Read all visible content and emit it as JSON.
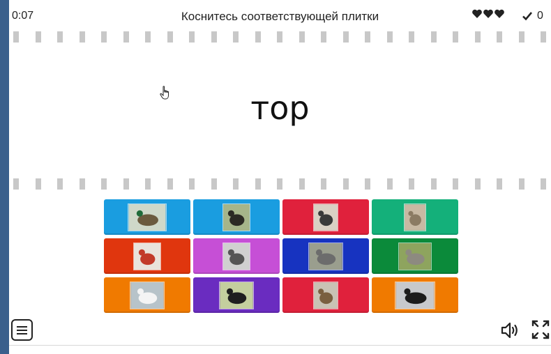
{
  "header": {
    "timer": "0:07",
    "prompt": "Коснитесь соответствующей плитки",
    "lives": 3,
    "score": "0",
    "heart_icon": "heart-icon",
    "check_icon": "checkmark-icon"
  },
  "question": {
    "word": "тор"
  },
  "tiles": [
    {
      "color": "#1a9de0",
      "image": "mallard-duck-photo"
    },
    {
      "color": "#1a9de0",
      "image": "capercaillie-photo"
    },
    {
      "color": "#e0213c",
      "image": "woodpecker-photo"
    },
    {
      "color": "#14b07a",
      "image": "bird-on-branch-photo"
    },
    {
      "color": "#e0360e",
      "image": "bullfinch-photo"
    },
    {
      "color": "#c64fd6",
      "image": "jackdaw-photo"
    },
    {
      "color": "#1733c0",
      "image": "crane-photo"
    },
    {
      "color": "#0b8a3a",
      "image": "goose-photo"
    },
    {
      "color": "#f07a00",
      "image": "swan-photo"
    },
    {
      "color": "#6a2cc0",
      "image": "magpie-photo"
    },
    {
      "color": "#e0213c",
      "image": "owl-photo"
    },
    {
      "color": "#f07a00",
      "image": "black-grouse-photo"
    }
  ],
  "controls": {
    "menu_icon": "menu-icon",
    "sound_icon": "speaker-icon",
    "fullscreen_icon": "fullscreen-icon"
  }
}
